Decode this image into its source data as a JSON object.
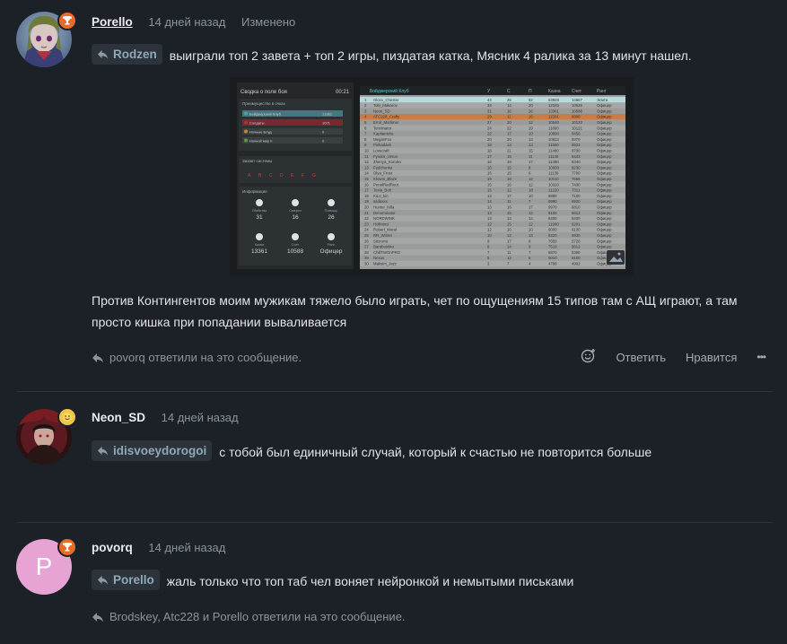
{
  "posts": [
    {
      "author": "Porello",
      "time": "14 дней назад",
      "edited": "Изменено",
      "mention": "Rodzen",
      "line1": "выиграли топ 2 завета + топ 2 игры, пиздатая катка, Мясник 4 ралика за 13 минут нашел.",
      "line2a": "Против Контингентов моим мужикам тяжело было играть, чет по ощущениям 15 типов там с АЩ играют, а там",
      "line2b": "просто кишка при попадании вываливается",
      "replied": "povorq ответили на это сообщение.",
      "react_label": "Ответить",
      "like_label": "Нравится",
      "more_label": "•••"
    },
    {
      "author": "Neon_SD",
      "time": "14 дней назад",
      "mention": "idisvoeydorogoi",
      "text": "с тобой был единичный случай, который к счастью не повторится больше"
    },
    {
      "author": "povorq",
      "time": "14 дней назад",
      "avatar_letter": "P",
      "mention": "Porello",
      "text": "жаль только что топ таб чел воняет нейронкой и немытыми письками",
      "replied": "Brodskey, Atc228 и Porello ответили на это сообщение."
    }
  ],
  "screenshot": {
    "left_title": "Сводка о поле боя",
    "timer": "00:21",
    "section1": "Преимущество в очках",
    "factions": [
      {
        "name": "Бойджерский Клуб",
        "score": "13361",
        "color": "#4fa3a8"
      },
      {
        "name": "Солдаты",
        "score": "1071",
        "color": "#a8343a"
      },
      {
        "name": "Ночные Блуд",
        "score": "0",
        "color": "#c9843a"
      },
      {
        "name": "Ночной мир II",
        "score": "0",
        "color": "#5b9a45"
      }
    ],
    "section2": "Захват системы",
    "zones": [
      "A",
      "B",
      "C",
      "D",
      "E",
      "F",
      "G"
    ],
    "section3": "Информация",
    "stats": [
      {
        "label": "Убийства",
        "value": "31"
      },
      {
        "label": "Смерти",
        "value": "16"
      },
      {
        "label": "Помощь",
        "value": "26"
      },
      {
        "label": "Казна",
        "value": "13361"
      },
      {
        "label": "Счет",
        "value": "10588"
      },
      {
        "label": "Ранг",
        "value": "Офицер"
      }
    ],
    "table_title": "Бойджерский Клуб",
    "columns": [
      "У",
      "С",
      "П",
      "Казна",
      "Счет",
      "Ранг"
    ],
    "rows": [
      [
        "Gloxx_Chester",
        "44",
        "25",
        "52",
        "63828",
        "14667",
        "Элита"
      ],
      [
        "Tobi_Makarov",
        "34",
        "14",
        "20",
        "12345",
        "10528",
        "Офицер"
      ],
      [
        "Neon_SD",
        "31",
        "16",
        "26",
        "13361",
        "10588",
        "Офицер"
      ],
      [
        "ATC228_Crafty",
        "29",
        "11",
        "16",
        "12201",
        "9800",
        "Офицер"
      ],
      [
        "Errol_Mortimer",
        "27",
        "20",
        "12",
        "10540",
        "10123",
        "Офицер"
      ],
      [
        "Terminator",
        "24",
        "22",
        "19",
        "11800",
        "10121",
        "Офицер"
      ],
      [
        "Kapitanishe",
        "22",
        "17",
        "10",
        "10800",
        "9456",
        "Офицер"
      ],
      [
        "MeganFox",
        "20",
        "20",
        "13",
        "10812",
        "9370",
        "Офицер"
      ],
      [
        "Pinkadash",
        "18",
        "13",
        "13",
        "11500",
        "8931",
        "Офицер"
      ],
      [
        "Lovecraft",
        "18",
        "21",
        "15",
        "11480",
        "8700",
        "Офицер"
      ],
      [
        "Fyodor_Ursus",
        "17",
        "15",
        "11",
        "11140",
        "8443",
        "Офицер"
      ],
      [
        "Zhenya_Korolev",
        "16",
        "19",
        "17",
        "11490",
        "8340",
        "Офицер"
      ],
      [
        "Fedchenko",
        "16",
        "15",
        "8",
        "10000",
        "8230",
        "Офицер"
      ],
      [
        "Olya_Frost",
        "16",
        "15",
        "6",
        "11130",
        "7790",
        "Офицер"
      ],
      [
        "Khavin_Blaze",
        "15",
        "18",
        "12",
        "10110",
        "7566",
        "Офицер"
      ],
      [
        "PenalRedRoot",
        "15",
        "16",
        "12",
        "10310",
        "7430",
        "Офицер"
      ],
      [
        "Tesla_Bolt",
        "15",
        "12",
        "18",
        "11220",
        "7311",
        "Офицер"
      ],
      [
        "KiLo_kin",
        "14",
        "17",
        "10",
        "9880",
        "7100",
        "Офицер"
      ],
      [
        "asdaxxx",
        "14",
        "11",
        "7",
        "8990",
        "6920",
        "Офицер"
      ],
      [
        "Hunter_Killa",
        "13",
        "16",
        "17",
        "9970",
        "6810",
        "Офицер"
      ],
      [
        "Denominator",
        "13",
        "15",
        "12",
        "8100",
        "6612",
        "Офицер"
      ],
      [
        "NORDWINK",
        "13",
        "13",
        "14",
        "8400",
        "6400",
        "Офицер"
      ],
      [
        "Hollmind",
        "12",
        "15",
        "12",
        "11900",
        "6201",
        "Офицер"
      ],
      [
        "Robert_Moral",
        "12",
        "10",
        "10",
        "9000",
        "6100",
        "Офицер"
      ],
      [
        "RR_Winter",
        "10",
        "12",
        "13",
        "8320",
        "5930",
        "Офицер"
      ],
      [
        "Sitoromt",
        "9",
        "17",
        "8",
        "7650",
        "5720",
        "Офицер"
      ],
      [
        "Baraboshko",
        "8",
        "14",
        "9",
        "7510",
        "5612",
        "Офицер"
      ],
      [
        "ChillTWOnPRO",
        "7",
        "11",
        "7",
        "6870",
        "5390",
        "Офицер"
      ],
      [
        "Nexus",
        "5",
        "12",
        "6",
        "6010",
        "5100",
        "Офицер"
      ],
      [
        "Maksim_Jazz",
        "3",
        "7",
        "4",
        "4798",
        "4902",
        "Офицер"
      ]
    ]
  }
}
